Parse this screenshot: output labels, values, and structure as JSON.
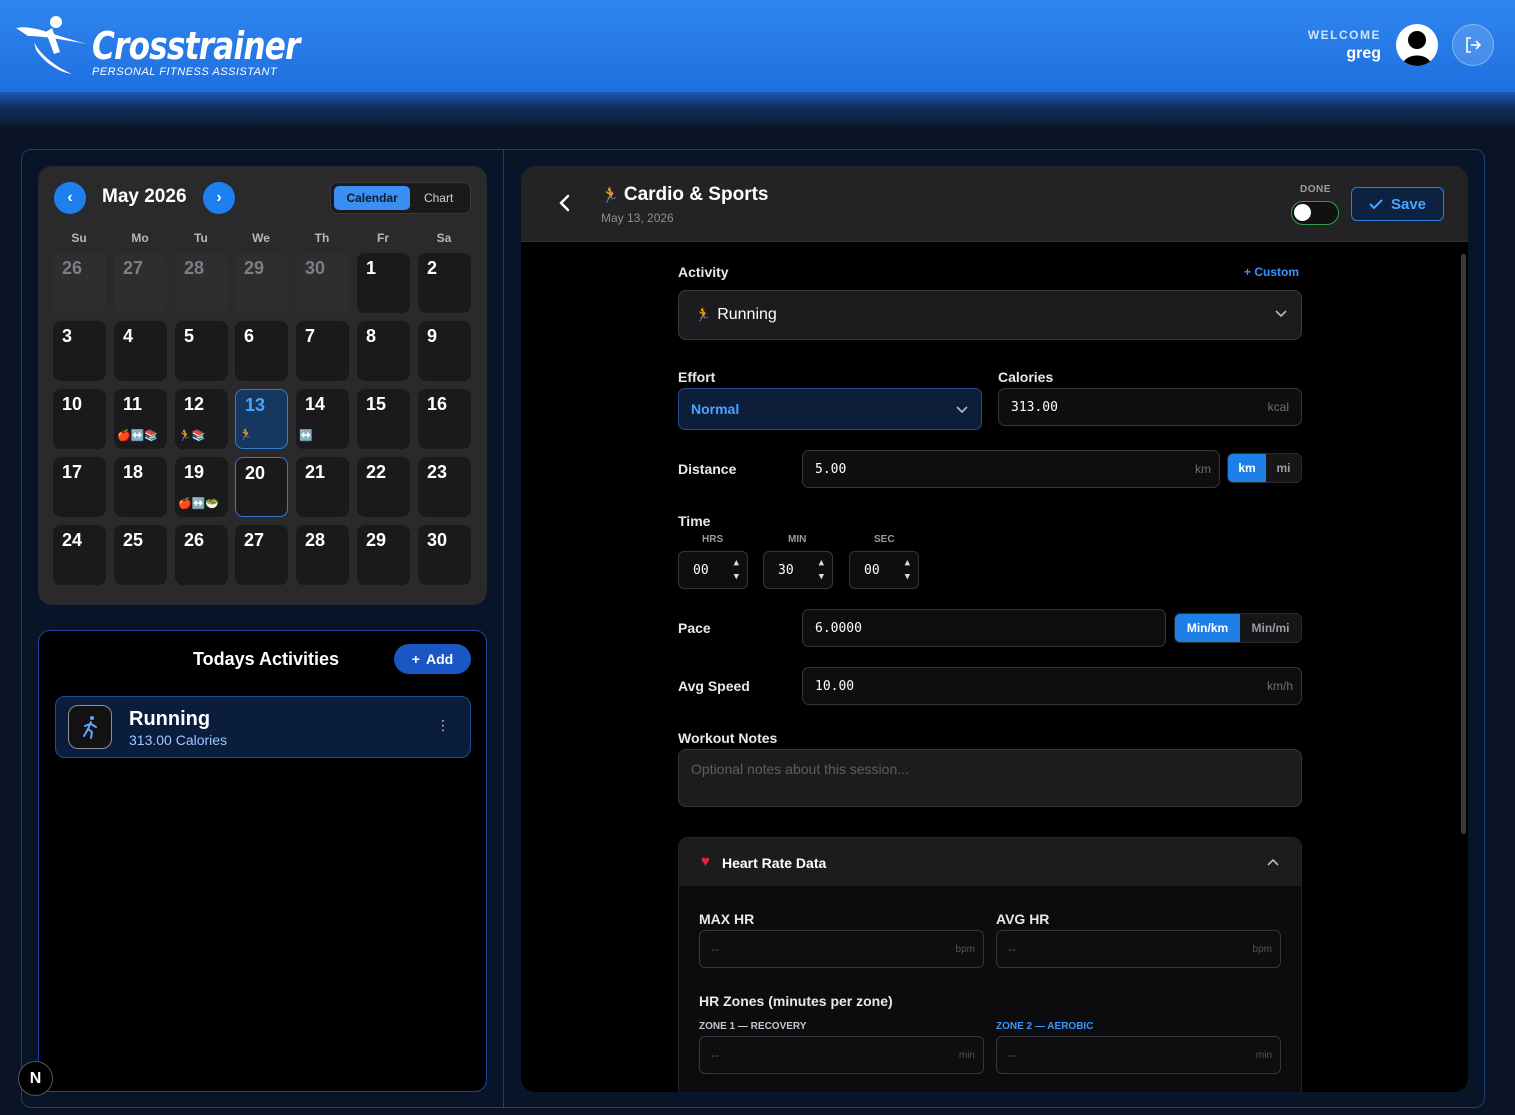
{
  "header": {
    "logo_title": "Crosstrainer",
    "logo_subtitle": "PERSONAL FITNESS ASSISTANT",
    "welcome_label": "WELCOME",
    "username": "greg",
    "colors": {
      "brand_blue": "#2f86f0",
      "accent": "#1f7ff0"
    }
  },
  "calendar": {
    "month_label": "May 2026",
    "prev_icon": "chevron-left-icon",
    "next_icon": "chevron-right-icon",
    "view_toggle": {
      "calendar": "Calendar",
      "chart": "Chart",
      "active": "Calendar"
    },
    "weekdays": [
      "Su",
      "Mo",
      "Tu",
      "We",
      "Th",
      "Fr",
      "Sa"
    ],
    "days": [
      {
        "d": "26",
        "other": true
      },
      {
        "d": "27",
        "other": true
      },
      {
        "d": "28",
        "other": true
      },
      {
        "d": "29",
        "other": true
      },
      {
        "d": "30",
        "other": true
      },
      {
        "d": "1"
      },
      {
        "d": "2"
      },
      {
        "d": "3"
      },
      {
        "d": "4"
      },
      {
        "d": "5"
      },
      {
        "d": "6"
      },
      {
        "d": "7"
      },
      {
        "d": "8"
      },
      {
        "d": "9"
      },
      {
        "d": "10"
      },
      {
        "d": "11",
        "icons": "🍎↔️📚"
      },
      {
        "d": "12",
        "icons": "🏃📚"
      },
      {
        "d": "13",
        "icons": "🏃",
        "today": true
      },
      {
        "d": "14",
        "icons": "↔️"
      },
      {
        "d": "15"
      },
      {
        "d": "16"
      },
      {
        "d": "17"
      },
      {
        "d": "18"
      },
      {
        "d": "19",
        "icons": "🍎↔️🥗"
      },
      {
        "d": "20",
        "selected": true
      },
      {
        "d": "21"
      },
      {
        "d": "22"
      },
      {
        "d": "23"
      },
      {
        "d": "24"
      },
      {
        "d": "25"
      },
      {
        "d": "26"
      },
      {
        "d": "27"
      },
      {
        "d": "28"
      },
      {
        "d": "29"
      },
      {
        "d": "30"
      }
    ]
  },
  "activities": {
    "title": "Todays Activities",
    "add_label": "Add",
    "items": [
      {
        "name": "Running",
        "calories": "313.00 Calories",
        "icon": "running-icon"
      }
    ]
  },
  "form": {
    "title": "Cardio & Sports",
    "date": "May 13, 2026",
    "done_label": "DONE",
    "done": false,
    "save_label": "Save",
    "activity_label": "Activity",
    "custom_label": "+ Custom",
    "activity_value": "Running",
    "effort_label": "Effort",
    "effort_value": "Normal",
    "calories_label": "Calories",
    "calories_value": "313.00",
    "calories_unit": "kcal",
    "distance_label": "Distance",
    "distance_value": "5.00",
    "distance_unit": "km",
    "distance_toggle": {
      "km": "km",
      "mi": "mi",
      "active": "km"
    },
    "time_label": "Time",
    "hrs_label": "HRS",
    "min_label": "MIN",
    "sec_label": "SEC",
    "hrs_value": "00",
    "min_value": "30",
    "sec_value": "00",
    "pace_label": "Pace",
    "pace_value": "6.0000",
    "pace_toggle": {
      "min_km": "Min/km",
      "min_mi": "Min/mi",
      "active": "Min/km"
    },
    "speed_label": "Avg Speed",
    "speed_value": "10.00",
    "speed_unit": "km/h",
    "notes_label": "Workout Notes",
    "notes_placeholder": "Optional notes about this session...",
    "hr": {
      "title": "Heart Rate Data",
      "max_label": "MAX HR",
      "avg_label": "AVG HR",
      "placeholder": "--",
      "bpm": "bpm",
      "zones_label": "HR Zones (minutes per zone)",
      "zone1_label": "ZONE 1 — RECOVERY",
      "zone2_label": "ZONE 2 — AEROBIC",
      "min_unit": "min"
    }
  },
  "badge": "N"
}
